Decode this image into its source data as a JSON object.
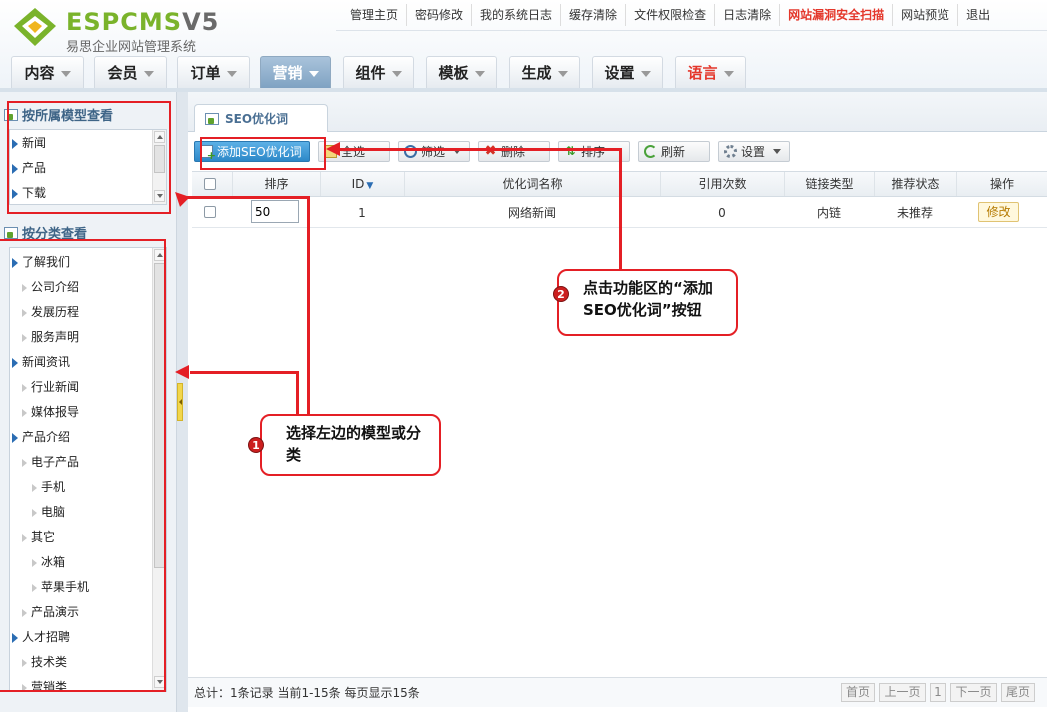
{
  "header": {
    "logo_text_espcms": "ESPCMS",
    "logo_text_version": "V5",
    "subtitle": "易思企业网站管理系统",
    "top_links": [
      {
        "label": "管理主页",
        "highlight": false
      },
      {
        "label": "密码修改",
        "highlight": false
      },
      {
        "label": "我的系统日志",
        "highlight": false
      },
      {
        "label": "缓存清除",
        "highlight": false
      },
      {
        "label": "文件权限检查",
        "highlight": false
      },
      {
        "label": "日志清除",
        "highlight": false
      },
      {
        "label": "网站漏洞安全扫描",
        "highlight": true
      },
      {
        "label": "网站预览",
        "highlight": false
      },
      {
        "label": "退出",
        "highlight": false
      }
    ],
    "main_tabs": [
      {
        "label": "内容",
        "active": false
      },
      {
        "label": "会员",
        "active": false
      },
      {
        "label": "订单",
        "active": false
      },
      {
        "label": "营销",
        "active": true
      },
      {
        "label": "组件",
        "active": false
      },
      {
        "label": "模板",
        "active": false
      },
      {
        "label": "生成",
        "active": false
      },
      {
        "label": "设置",
        "active": false
      },
      {
        "label": "语言",
        "active": false,
        "accent": "#e4372b"
      }
    ]
  },
  "sidebar": {
    "model_panel": {
      "title": "按所属模型查看",
      "items": [
        "新闻",
        "产品",
        "下载"
      ]
    },
    "category_panel": {
      "title": "按分类查看",
      "items": [
        {
          "label": "了解我们",
          "level": 0
        },
        {
          "label": "公司介绍",
          "level": 1
        },
        {
          "label": "发展历程",
          "level": 1
        },
        {
          "label": "服务声明",
          "level": 1
        },
        {
          "label": "新闻资讯",
          "level": 0
        },
        {
          "label": "行业新闻",
          "level": 1
        },
        {
          "label": "媒体报导",
          "level": 1
        },
        {
          "label": "产品介绍",
          "level": 0
        },
        {
          "label": "电子产品",
          "level": 1
        },
        {
          "label": "手机",
          "level": 2
        },
        {
          "label": "电脑",
          "level": 2
        },
        {
          "label": "其它",
          "level": 1
        },
        {
          "label": "冰箱",
          "level": 2
        },
        {
          "label": "苹果手机",
          "level": 2
        },
        {
          "label": "产品演示",
          "level": 1
        },
        {
          "label": "人才招聘",
          "level": 0
        },
        {
          "label": "技术类",
          "level": 1
        },
        {
          "label": "营销类",
          "level": 1
        }
      ]
    }
  },
  "main": {
    "tab_label": "SEO优化词",
    "toolbar": {
      "add_label": "添加SEO优化词",
      "select_all_label": "全选",
      "filter_label": "筛选",
      "delete_label": "删除",
      "sort_label": "排序",
      "refresh_label": "刷新",
      "settings_label": "设置"
    },
    "table": {
      "columns": [
        "排序",
        "ID",
        "优化词名称",
        "引用次数",
        "链接类型",
        "推荐状态",
        "操作"
      ],
      "rows": [
        {
          "sort": "50",
          "id": "1",
          "name": "网络新闻",
          "refs": "0",
          "link_type": "内链",
          "status": "未推荐",
          "action": "修改"
        }
      ]
    },
    "footer": {
      "summary": "总计：1条记录 当前1-15条 每页显示15条",
      "pager": [
        "首页",
        "上一页",
        "1",
        "下一页",
        "尾页"
      ]
    }
  },
  "annotations": {
    "step1_badge": "1",
    "step1_text": "选择左边的模型或分类",
    "step2_badge": "2",
    "step2_text": "点击功能区的“添加SEO优化词”按钮",
    "color": "#e41f25"
  }
}
